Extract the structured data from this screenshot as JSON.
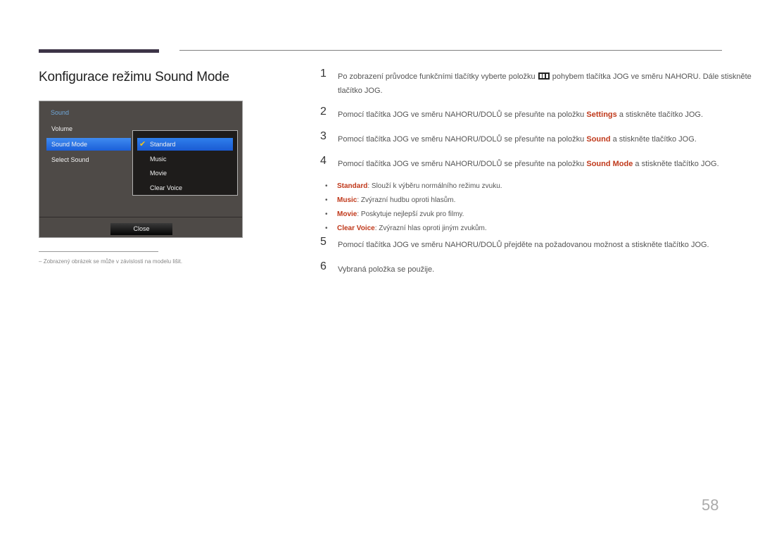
{
  "page": {
    "title": "Konfigurace režimu Sound Mode",
    "page_number": "58",
    "note": "Zobrazený obrázek se může v závislosti na modelu lišit.",
    "note_dash": "–"
  },
  "osd": {
    "header": "Sound",
    "menu_items": [
      {
        "label": "Volume",
        "selected": false
      },
      {
        "label": "Sound Mode",
        "selected": true
      },
      {
        "label": "Select Sound",
        "selected": false
      }
    ],
    "submenu_items": [
      {
        "label": "Standard",
        "selected": true
      },
      {
        "label": "Music",
        "selected": false
      },
      {
        "label": "Movie",
        "selected": false
      },
      {
        "label": "Clear Voice",
        "selected": false
      }
    ],
    "check_icon": "✔",
    "close_label": "Close"
  },
  "steps": [
    {
      "num": "1",
      "before": "Po zobrazení průvodce funkčními tlačítky vyberte položku ",
      "icon": "menu-icon",
      "after": " pohybem tlačítka JOG ve směru NAHORU. Dále stiskněte",
      "line2": "tlačítko JOG."
    },
    {
      "num": "2",
      "before": "Pomocí tlačítka JOG ve směru NAHORU/DOLŮ se přesuňte na položku ",
      "highlight": "Settings",
      "after": " a stiskněte tlačítko JOG."
    },
    {
      "num": "3",
      "before": "Pomocí tlačítka JOG ve směru NAHORU/DOLŮ se přesuňte na položku ",
      "highlight": "Sound",
      "after": " a stiskněte tlačítko JOG."
    },
    {
      "num": "4",
      "before": "Pomocí tlačítka JOG ve směru NAHORU/DOLŮ se přesuňte na položku ",
      "highlight": "Sound Mode",
      "after": " a stiskněte tlačítko JOG."
    },
    {
      "num": "5",
      "text": "Pomocí tlačítka JOG ve směru NAHORU/DOLŮ přejděte na požadovanou možnost a stiskněte tlačítko JOG."
    },
    {
      "num": "6",
      "text": "Vybraná položka se použije."
    }
  ],
  "bullets": [
    {
      "term": "Standard",
      "desc": ": Slouží k výběru normálního režimu zvuku."
    },
    {
      "term": "Music",
      "desc": ": Zvýrazní hudbu oproti hlasům."
    },
    {
      "term": "Movie",
      "desc": ": Poskytuje nejlepší zvuk pro filmy."
    },
    {
      "term": "Clear Voice",
      "desc": ": Zvýrazní hlas oproti jiným zvukům."
    }
  ],
  "bullet_glyph": "•",
  "colors": {
    "highlight": "#c0391b",
    "selection": "#2f7fec",
    "check": "#f5c518"
  }
}
